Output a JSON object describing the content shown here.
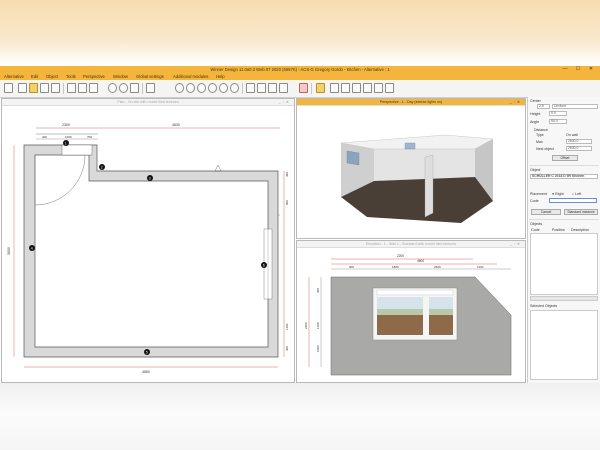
{
  "window": {
    "title": "Winner Design 11.0a0.3  Web 07 2020 (6697K)  - ACS-G Gregory Gordo - Kitchen - Alternative : 1",
    "controls": {
      "minimize": "—",
      "maximize": "☐",
      "close": "✕"
    }
  },
  "menu": [
    "Alternative",
    "Edit",
    "Object",
    "Tools",
    "Perspective",
    "Window",
    "Global settings",
    "Additional modules",
    "Help"
  ],
  "panels": {
    "plan": {
      "title": "Plan - On site with model tiled textures"
    },
    "perspective": {
      "title": "Perspective - 1 - Day (interior lights on)"
    },
    "elevation": {
      "title": "Elevation - 1 - Wall 1 - Standard with model tiled textures"
    }
  },
  "plan_dims": {
    "top_total": "4630",
    "top_left": "2300",
    "seg1": "400",
    "seg2": "1000",
    "seg3": "700",
    "left": "3600",
    "bottom": "4560",
    "right_top": "480",
    "right_mid": "800",
    "right_low": "1100",
    "right_bot": "400",
    "labels": [
      "1",
      "2",
      "3",
      "4",
      "5",
      "6"
    ]
  },
  "elevation_dims": {
    "top_total": "4600",
    "top_a": "2200",
    "top_b": "2500",
    "seg_a": "900",
    "seg_b": "1800",
    "seg_c": "2600",
    "seg_d": "1100",
    "left_a": "400",
    "left_b": "1300",
    "left_c": "1000",
    "left_total": "2400"
  },
  "properties": {
    "center_label": "Center",
    "center_value": "2.5",
    "center_option": "On floor",
    "height_label": "Height",
    "height_value": "0.0",
    "angle_label": "Angle",
    "angle_value": "90.0",
    "distance_label": "Distance",
    "type_label": "Type",
    "type_value": "On wall",
    "max_label": "Max",
    "max_value": "2600.0",
    "next_object_label": "Next object",
    "next_object_value": "2600.0",
    "offset_button": "Offset",
    "object_label": "Object",
    "object_value": "SCHÜLLER C 2018 D 5R Kitchen",
    "placement_label": "Placement",
    "placement_right": "Right",
    "placement_left": "Left",
    "code_label": "Code",
    "cancel_button": "Cancel",
    "standard_button": "Standard instance",
    "objects_label": "Objects",
    "col_code": "Code",
    "col_position": "Position",
    "col_description": "Description",
    "selected_label": "Selected Objects"
  },
  "colors": {
    "accent": "#f3b53b",
    "wall": "#d9d9d9",
    "floor": "#4a3f36"
  }
}
